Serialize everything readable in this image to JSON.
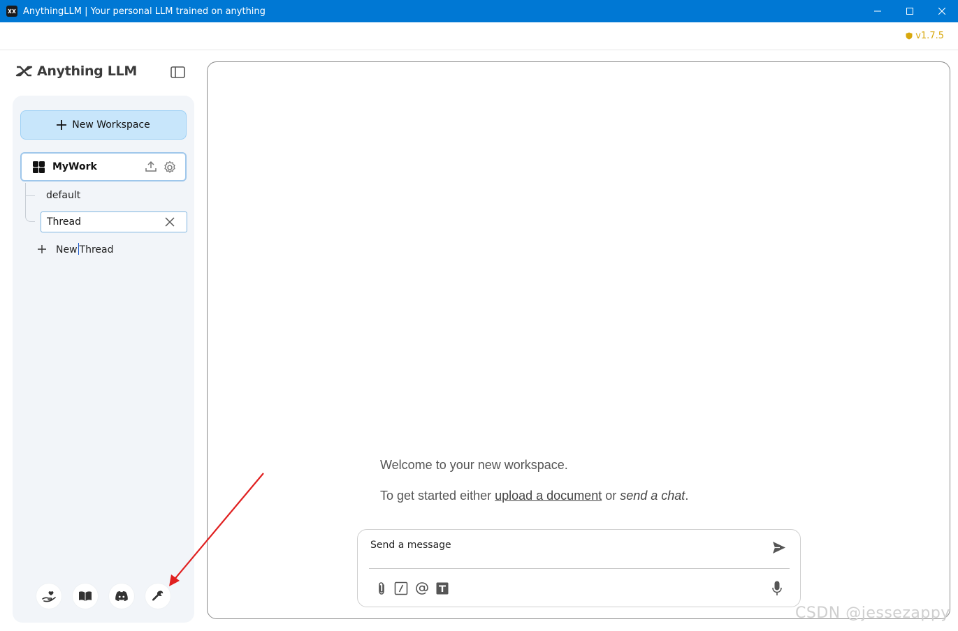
{
  "window": {
    "title": "AnythingLLM | Your personal LLM trained on anything"
  },
  "header": {
    "version": "v1.7.5"
  },
  "sidebar": {
    "brand": "Anything LLM",
    "new_workspace_label": "New Workspace",
    "workspace": {
      "name": "MyWork"
    },
    "threads": [
      {
        "label": "default"
      }
    ],
    "editing_thread_value": "Thread",
    "new_thread_label": "New Thread",
    "new_thread_before": "New",
    "new_thread_after": "Thread"
  },
  "main": {
    "welcome": "Welcome to your new workspace.",
    "get_started_prefix": "To get started either ",
    "upload_link": "upload a document",
    "or_text": " or ",
    "send_chat": "send a chat",
    "period": "."
  },
  "composer": {
    "placeholder": "Send a message"
  },
  "watermark": "CSDN @jessezappy",
  "colors": {
    "titlebar": "#0078d4",
    "version": "#d8a80d",
    "new_workspace_bg": "#c8e6fb",
    "annotation_arrow": "#e02020"
  }
}
